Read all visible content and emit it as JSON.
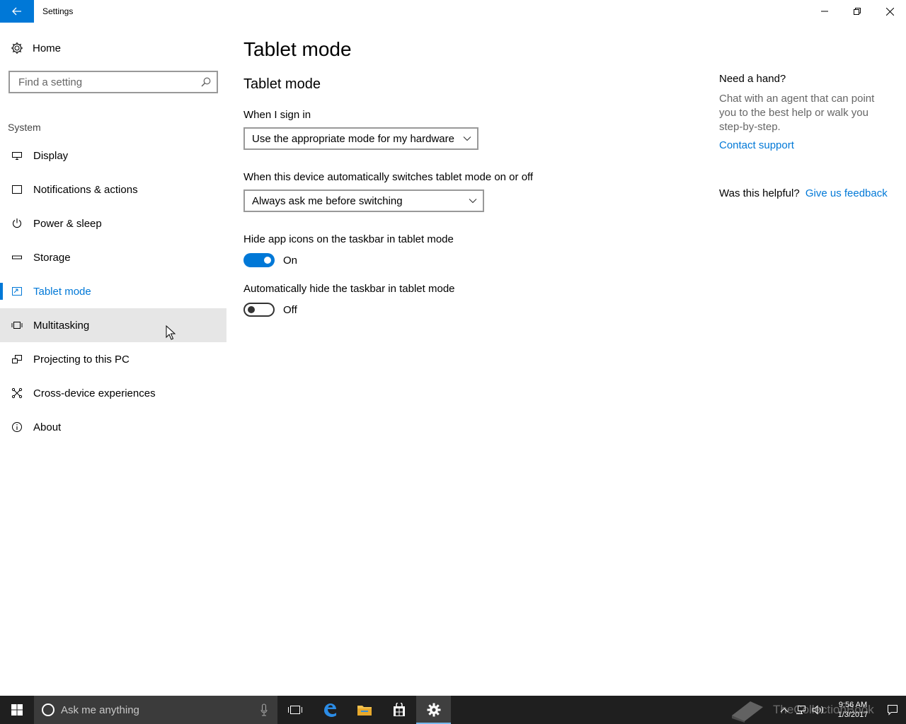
{
  "window": {
    "title": "Settings"
  },
  "sidebar": {
    "home_label": "Home",
    "search_placeholder": "Find a setting",
    "section_label": "System",
    "items": [
      {
        "label": "Display",
        "icon": "display-icon"
      },
      {
        "label": "Notifications & actions",
        "icon": "notifications-icon"
      },
      {
        "label": "Power & sleep",
        "icon": "power-icon"
      },
      {
        "label": "Storage",
        "icon": "storage-icon"
      },
      {
        "label": "Tablet mode",
        "icon": "tablet-mode-icon",
        "active": true
      },
      {
        "label": "Multitasking",
        "icon": "multitasking-icon",
        "hover": true
      },
      {
        "label": "Projecting to this PC",
        "icon": "projecting-icon"
      },
      {
        "label": "Cross-device experiences",
        "icon": "cross-device-icon"
      },
      {
        "label": "About",
        "icon": "info-icon"
      }
    ]
  },
  "main": {
    "page_title": "Tablet mode",
    "section_title": "Tablet mode",
    "sign_in_label": "When I sign in",
    "sign_in_value": "Use the appropriate mode for my hardware",
    "switch_label": "When this device automatically switches tablet mode on or off",
    "switch_value": "Always ask me before switching",
    "hide_icons_label": "Hide app icons on the taskbar in tablet mode",
    "hide_icons_state": "On",
    "hide_taskbar_label": "Automatically hide the taskbar in tablet mode",
    "hide_taskbar_state": "Off"
  },
  "help": {
    "heading": "Need a hand?",
    "text": "Chat with an agent that can point you to the best help or walk you step-by-step.",
    "contact_link": "Contact support",
    "helpful_label": "Was this helpful?",
    "feedback_link": "Give us feedback"
  },
  "taskbar": {
    "search_placeholder": "Ask me anything",
    "time": "9:56 AM",
    "date": "1/3/2017",
    "watermark": "TheCollectionBook"
  },
  "colors": {
    "accent": "#0078d7",
    "taskbar": "#1f1f1f",
    "hover": "#e6e6e6"
  }
}
